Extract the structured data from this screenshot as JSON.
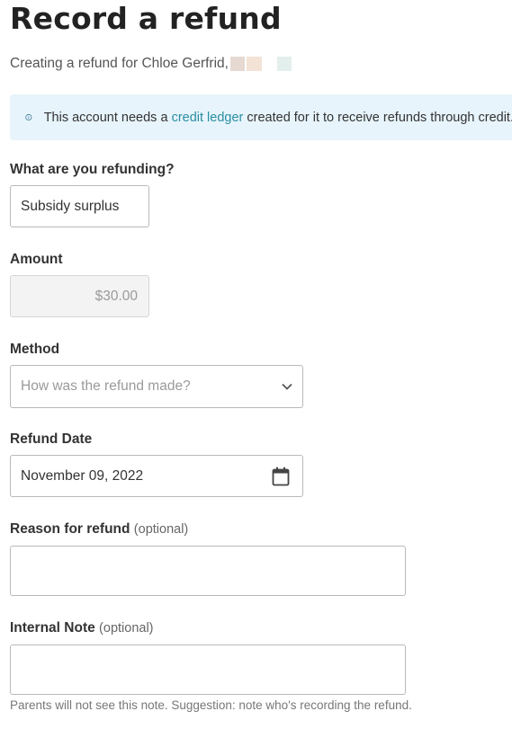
{
  "page": {
    "title": "Record a refund",
    "subtitle": "Creating a refund for Chloe Gerfrid,"
  },
  "banner": {
    "text_before": "This account needs a ",
    "link": "credit ledger",
    "text_after": " created for it to receive refunds through credit."
  },
  "form": {
    "what": {
      "label": "What are you refunding?",
      "value": "Subsidy surplus"
    },
    "amount": {
      "label": "Amount",
      "value": "$30.00"
    },
    "method": {
      "label": "Method",
      "placeholder": "How was the refund made?"
    },
    "date": {
      "label": "Refund Date",
      "value": "November 09, 2022"
    },
    "reason": {
      "label": "Reason for refund",
      "optional": "(optional)",
      "value": ""
    },
    "note": {
      "label": "Internal Note",
      "optional": "(optional)",
      "value": "",
      "hint": "Parents will not see this note. Suggestion: note who's recording the refund."
    }
  },
  "icons": {
    "info": "info-circle-icon",
    "chevron": "chevron-down-icon",
    "calendar": "calendar-icon"
  },
  "colors": {
    "banner_bg": "#e7f4fb",
    "link": "#2a8ea3",
    "info_icon": "#2b6f8e"
  }
}
